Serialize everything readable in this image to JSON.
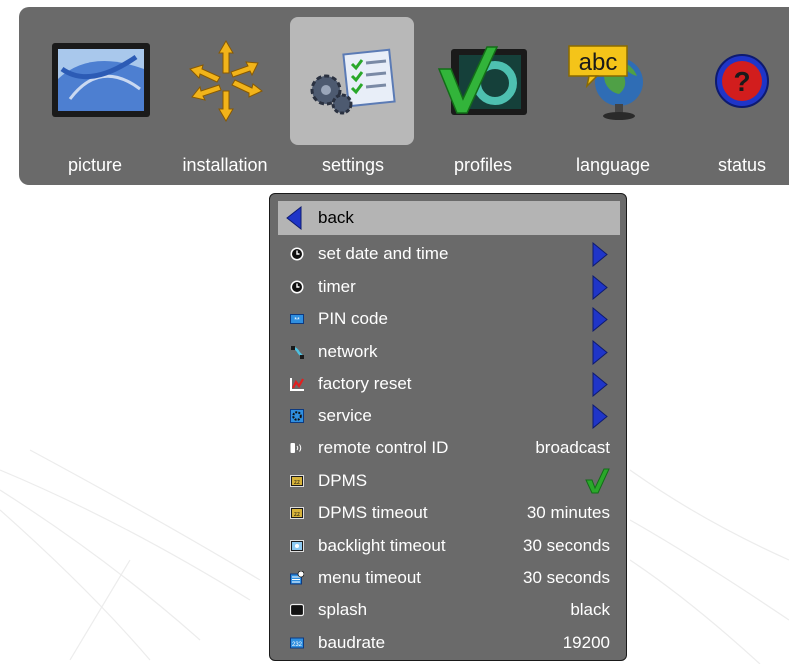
{
  "nav": {
    "items": [
      {
        "id": "picture",
        "label": "picture",
        "icon": "picture-icon"
      },
      {
        "id": "installation",
        "label": "installation",
        "icon": "installation-icon"
      },
      {
        "id": "settings",
        "label": "settings",
        "icon": "settings-icon"
      },
      {
        "id": "profiles",
        "label": "profiles",
        "icon": "profiles-icon"
      },
      {
        "id": "language",
        "label": "language",
        "icon": "language-icon",
        "icon_text": "abc"
      },
      {
        "id": "status",
        "label": "status",
        "icon": "status-icon",
        "icon_text": "?"
      }
    ],
    "active": "settings"
  },
  "menu": {
    "back_label": "back",
    "items": [
      {
        "label": "set date and time",
        "icon": "clock-icon",
        "control": "submenu"
      },
      {
        "label": "timer",
        "icon": "clock-icon",
        "control": "submenu"
      },
      {
        "label": "PIN code",
        "icon": "pin-code-icon",
        "control": "submenu"
      },
      {
        "label": "network",
        "icon": "network-icon",
        "control": "submenu"
      },
      {
        "label": "factory reset",
        "icon": "factory-reset-icon",
        "control": "submenu"
      },
      {
        "label": "service",
        "icon": "service-icon",
        "control": "submenu"
      },
      {
        "label": "remote control ID",
        "icon": "remote-control-icon",
        "value": "broadcast"
      },
      {
        "label": "DPMS",
        "icon": "dpms-icon",
        "checked": true
      },
      {
        "label": "DPMS timeout",
        "icon": "dpms-icon",
        "value": "30 minutes"
      },
      {
        "label": "backlight timeout",
        "icon": "backlight-icon",
        "value": "30 seconds"
      },
      {
        "label": "menu timeout",
        "icon": "menu-timeout-icon",
        "value": "30 seconds"
      },
      {
        "label": "splash",
        "icon": "splash-icon",
        "value": "black"
      },
      {
        "label": "baudrate",
        "icon": "baudrate-icon",
        "icon_text": "232",
        "value": "19200"
      }
    ]
  },
  "colors": {
    "bar": "#6a6a6a",
    "selected": "#b4b4b4",
    "arrow": "#1f35c8",
    "check": "#2aa82a"
  }
}
